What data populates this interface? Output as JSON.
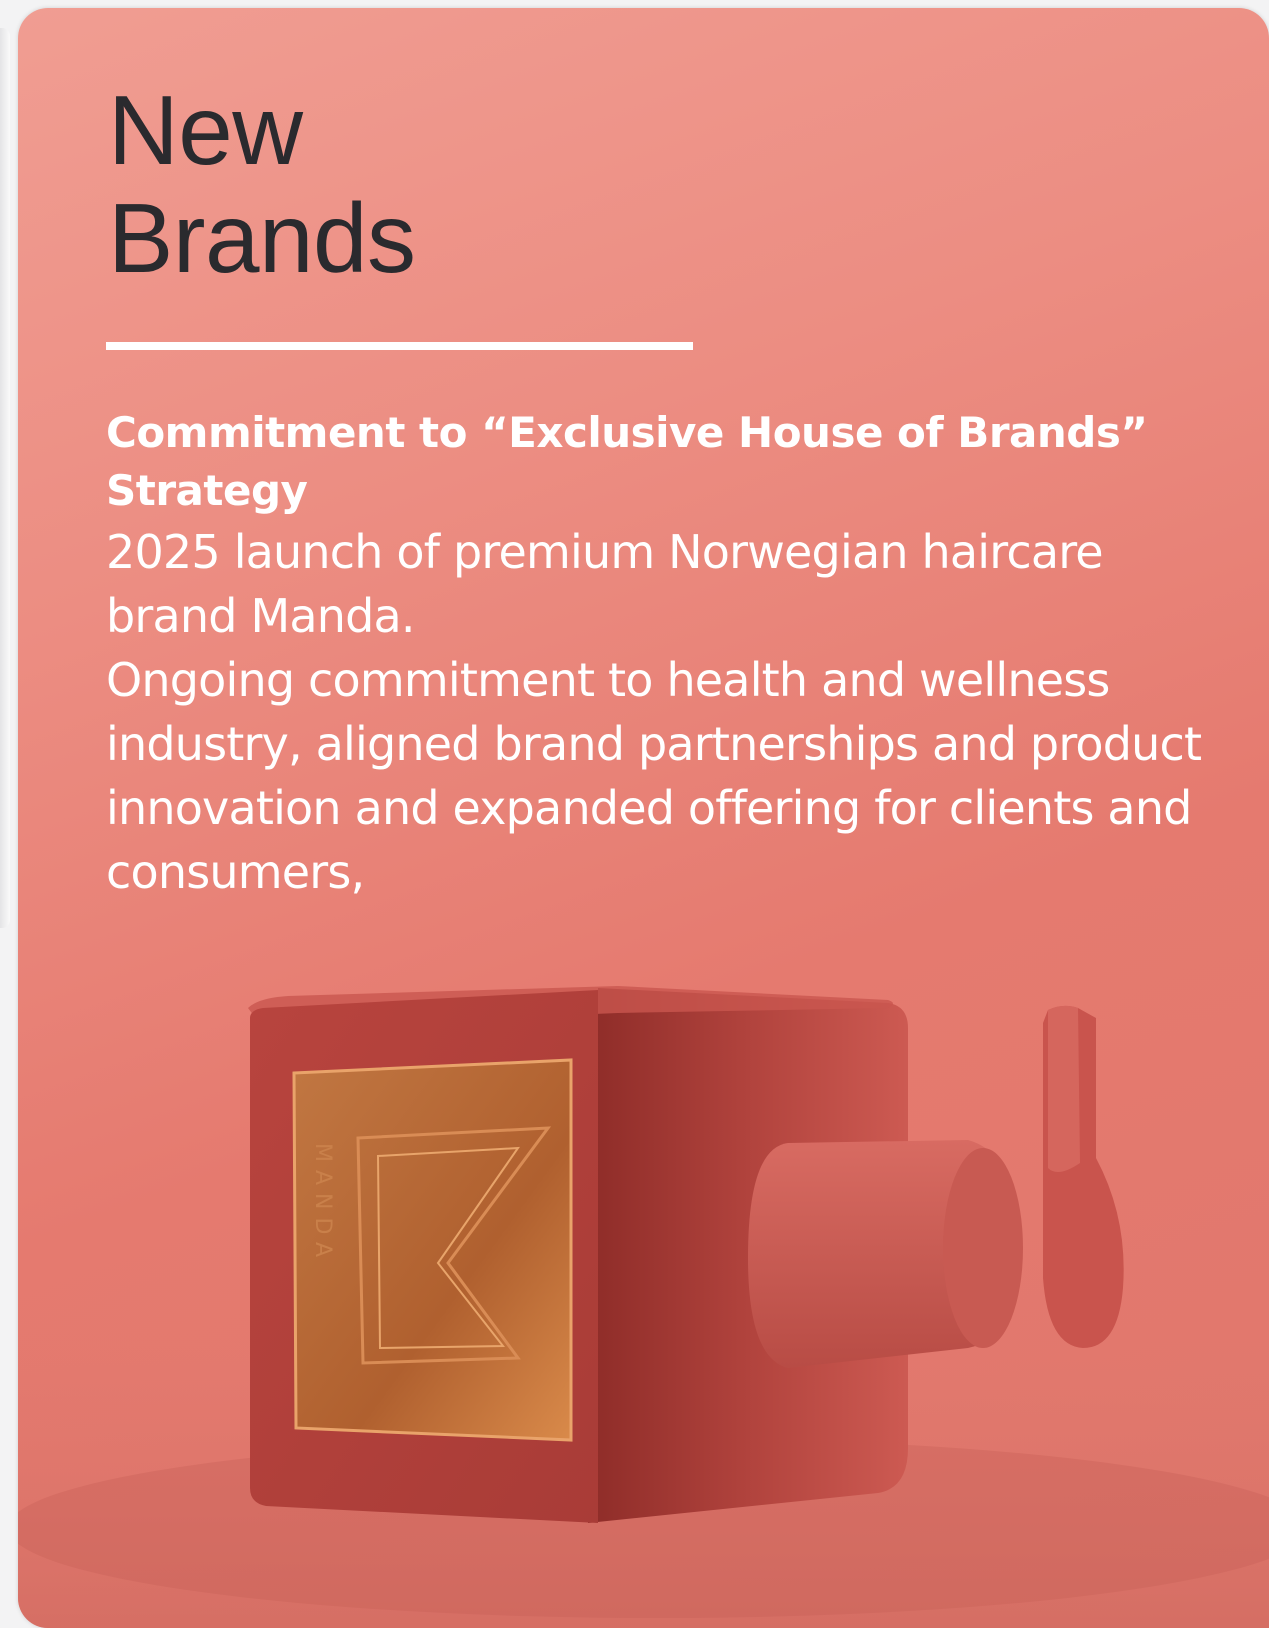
{
  "card": {
    "title_line1": "New",
    "title_line2": "Brands",
    "heading": "Commitment to “Exclusive House of Brands” Strategy",
    "paragraph1": "2025 launch of premium Norwegian haircare brand Manda.",
    "paragraph2": "Ongoing commitment to health and wellness industry, aligned brand partnerships and product innovation and expanded offering for clients and consumers,"
  },
  "product": {
    "logo_text": "MANDA"
  },
  "colors": {
    "card_background": "#ec8d82",
    "title_text": "#2a2a2e",
    "body_text": "#ffffff",
    "bottle": "#c24c45",
    "plaque": "#b8683a"
  }
}
